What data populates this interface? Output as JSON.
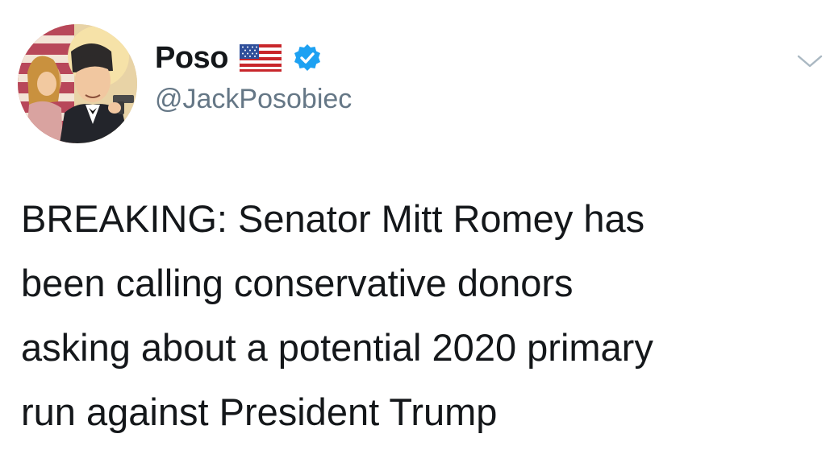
{
  "author": {
    "display_name": "Poso",
    "handle": "@JackPosobiec",
    "verified": true,
    "flag_icon": "us-flag-icon",
    "avatar_icon": "comic-portrait-avatar"
  },
  "tweet": {
    "text": "BREAKING: Senator Mitt Romey has\nbeen calling conservative donors\nasking about a potential 2020 primary\nrun against President Trump"
  },
  "menu": {
    "icon": "chevron-down-icon"
  },
  "colors": {
    "text": "#14171a",
    "secondary": "#657786",
    "verified_blue": "#1da1f2",
    "background": "#ffffff"
  }
}
